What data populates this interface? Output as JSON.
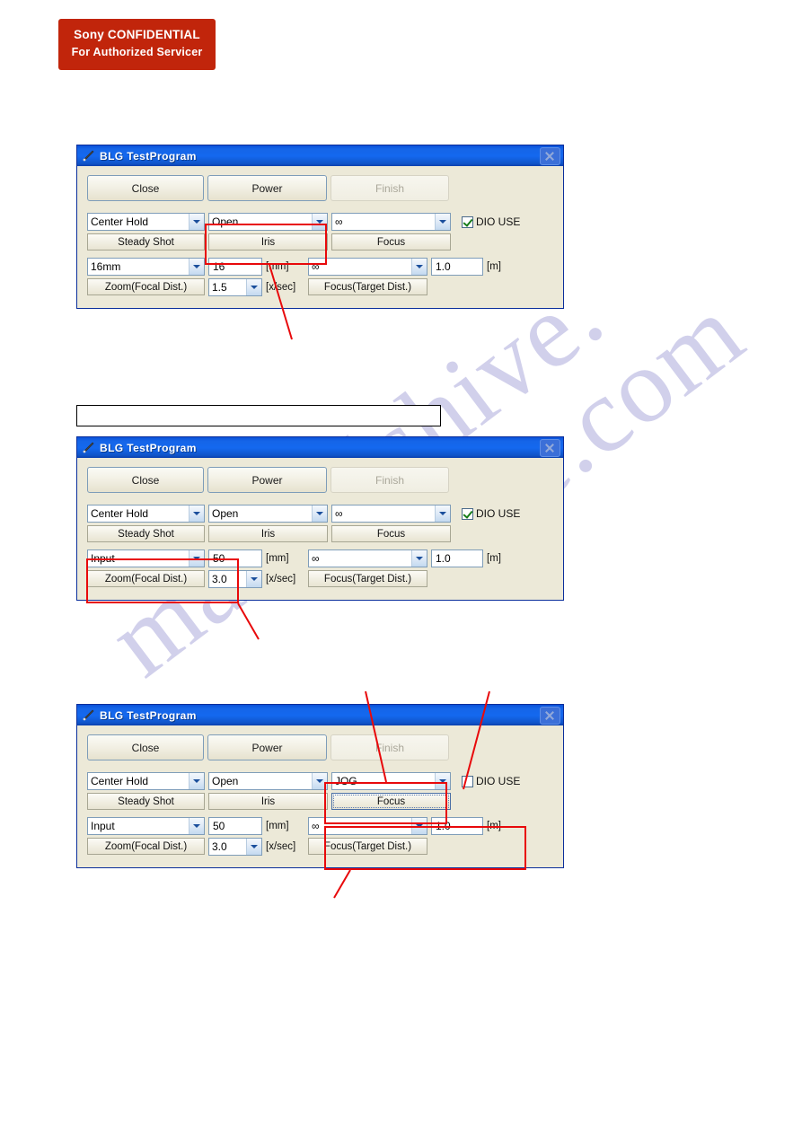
{
  "banner": {
    "line1": "Sony CONFIDENTIAL",
    "line2": "For Authorized Servicer"
  },
  "watermark": {
    "text_left": "manualshive.",
    "text_right": "ve.com"
  },
  "note_box": {
    "value": "",
    "placeholder": ""
  },
  "colors": {
    "banner_bg": "#c1250b",
    "title_bar": "#1468ef",
    "dialog_face": "#ece9d8",
    "highlight_red": "#e8090b",
    "check_green": "#177c18",
    "watermark": "#c9c8e8"
  },
  "dialogs": [
    {
      "title": "BLG TestProgram",
      "close_label": "×",
      "buttons": {
        "close": "Close",
        "power": "Power",
        "finish": "Finish"
      },
      "row1": {
        "steady_combo": "Center Hold",
        "steady_button": "Steady Shot",
        "iris_combo": "Open",
        "iris_button": "Iris",
        "focus_combo": "∞",
        "focus_button": "Focus",
        "dio_label": "DIO USE",
        "dio_checked": true
      },
      "row2": {
        "zoom_combo": "16mm",
        "zoom_button": "Zoom(Focal Dist.)",
        "zoom_value": "16",
        "zoom_unit": "[mm]",
        "speed_value": "1.5",
        "speed_unit": "[x/sec]",
        "focus_combo": "∞",
        "focus_button": "Focus(Target Dist.)",
        "focus_value": "1.0",
        "focus_unit": "[m]"
      },
      "highlights": [
        "iris-group"
      ]
    },
    {
      "title": "BLG TestProgram",
      "close_label": "×",
      "buttons": {
        "close": "Close",
        "power": "Power",
        "finish": "Finish"
      },
      "row1": {
        "steady_combo": "Center Hold",
        "steady_button": "Steady Shot",
        "iris_combo": "Open",
        "iris_button": "Iris",
        "focus_combo": "∞",
        "focus_button": "Focus",
        "dio_label": "DIO USE",
        "dio_checked": true
      },
      "row2": {
        "zoom_combo": "Input",
        "zoom_button": "Zoom(Focal Dist.)",
        "zoom_value": "50",
        "zoom_unit": "[mm]",
        "speed_value": "3.0",
        "speed_unit": "[x/sec]",
        "focus_combo": "∞",
        "focus_button": "Focus(Target Dist.)",
        "focus_value": "1.0",
        "focus_unit": "[m]"
      },
      "highlights": [
        "zoom-group"
      ]
    },
    {
      "title": "BLG TestProgram",
      "close_label": "×",
      "buttons": {
        "close": "Close",
        "power": "Power",
        "finish": "Finish"
      },
      "row1": {
        "steady_combo": "Center Hold",
        "steady_button": "Steady Shot",
        "iris_combo": "Open",
        "iris_button": "Iris",
        "focus_combo": "JOG",
        "focus_button": "Focus",
        "dio_label": "DIO USE",
        "dio_checked": false
      },
      "row2": {
        "zoom_combo": "Input",
        "zoom_button": "Zoom(Focal Dist.)",
        "zoom_value": "50",
        "zoom_unit": "[mm]",
        "speed_value": "3.0",
        "speed_unit": "[x/sec]",
        "focus_combo": "∞",
        "focus_button": "Focus(Target Dist.)",
        "focus_value": "1.0",
        "focus_unit": "[m]"
      },
      "highlights": [
        "focus-group",
        "focus-target-group"
      ]
    }
  ]
}
